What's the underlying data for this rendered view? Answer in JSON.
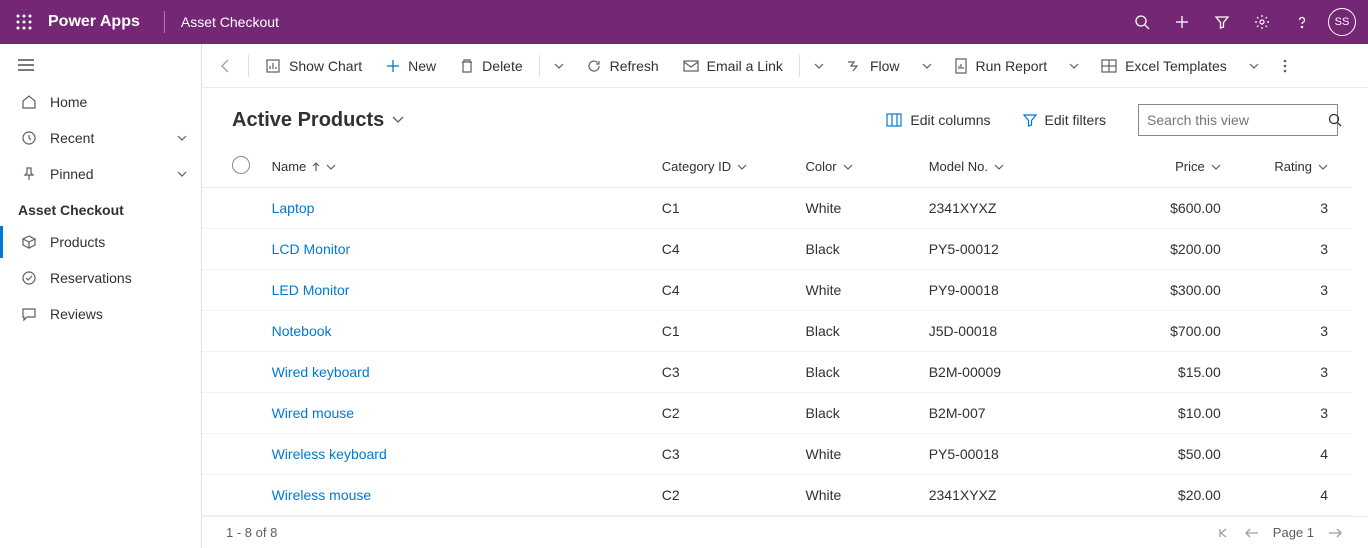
{
  "header": {
    "app_name": "Power Apps",
    "environment": "Asset Checkout",
    "avatar_initials": "SS"
  },
  "sidebar": {
    "home": "Home",
    "recent": "Recent",
    "pinned": "Pinned",
    "group_title": "Asset Checkout",
    "products": "Products",
    "reservations": "Reservations",
    "reviews": "Reviews"
  },
  "commands": {
    "show_chart": "Show Chart",
    "new": "New",
    "delete": "Delete",
    "refresh": "Refresh",
    "email_link": "Email a Link",
    "flow": "Flow",
    "run_report": "Run Report",
    "excel_templates": "Excel Templates"
  },
  "view": {
    "title": "Active Products",
    "edit_columns": "Edit columns",
    "edit_filters": "Edit filters",
    "search_placeholder": "Search this view"
  },
  "columns": {
    "name": "Name",
    "category": "Category ID",
    "color": "Color",
    "model": "Model No.",
    "price": "Price",
    "rating": "Rating"
  },
  "rows": [
    {
      "name": "Laptop",
      "category": "C1",
      "color": "White",
      "model": "2341XYXZ",
      "price": "$600.00",
      "rating": "3"
    },
    {
      "name": "LCD Monitor",
      "category": "C4",
      "color": "Black",
      "model": "PY5-00012",
      "price": "$200.00",
      "rating": "3"
    },
    {
      "name": "LED Monitor",
      "category": "C4",
      "color": "White",
      "model": "PY9-00018",
      "price": "$300.00",
      "rating": "3"
    },
    {
      "name": "Notebook",
      "category": "C1",
      "color": "Black",
      "model": "J5D-00018",
      "price": "$700.00",
      "rating": "3"
    },
    {
      "name": "Wired keyboard",
      "category": "C3",
      "color": "Black",
      "model": "B2M-00009",
      "price": "$15.00",
      "rating": "3"
    },
    {
      "name": "Wired mouse",
      "category": "C2",
      "color": "Black",
      "model": "B2M-007",
      "price": "$10.00",
      "rating": "3"
    },
    {
      "name": "Wireless keyboard",
      "category": "C3",
      "color": "White",
      "model": "PY5-00018",
      "price": "$50.00",
      "rating": "4"
    },
    {
      "name": "Wireless mouse",
      "category": "C2",
      "color": "White",
      "model": "2341XYXZ",
      "price": "$20.00",
      "rating": "4"
    }
  ],
  "footer": {
    "range": "1 - 8 of 8",
    "page_label": "Page 1"
  }
}
